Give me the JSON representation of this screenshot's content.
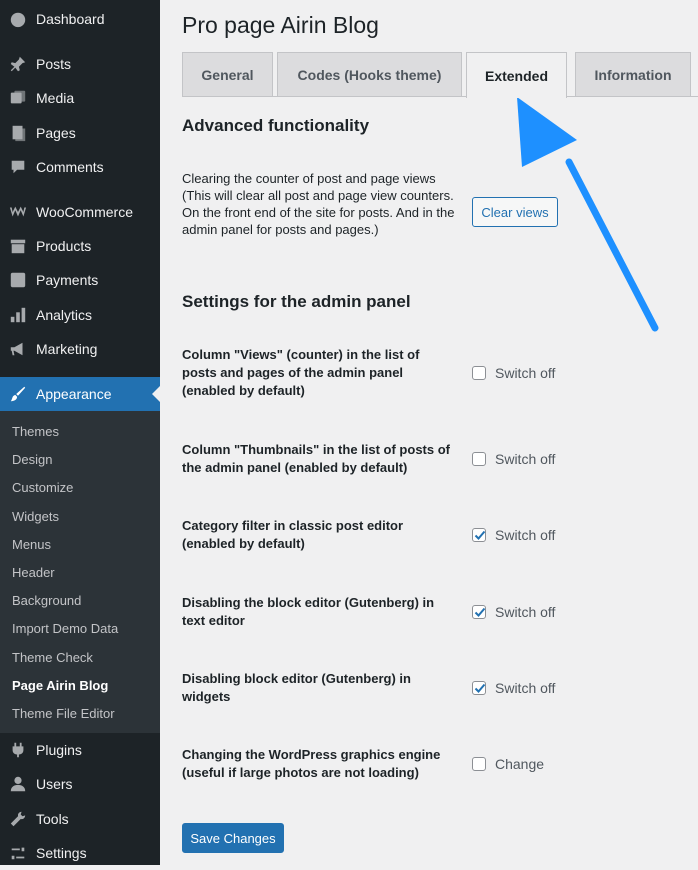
{
  "sidebar": {
    "items": [
      {
        "label": "Dashboard",
        "icon": "dashboard-icon"
      },
      {
        "label": "Posts",
        "icon": "pin-icon"
      },
      {
        "label": "Media",
        "icon": "media-icon"
      },
      {
        "label": "Pages",
        "icon": "pages-icon"
      },
      {
        "label": "Comments",
        "icon": "comments-icon"
      },
      {
        "label": "WooCommerce",
        "icon": "woocommerce-icon"
      },
      {
        "label": "Products",
        "icon": "products-icon"
      },
      {
        "label": "Payments",
        "icon": "payments-icon"
      },
      {
        "label": "Analytics",
        "icon": "analytics-icon"
      },
      {
        "label": "Marketing",
        "icon": "megaphone-icon"
      },
      {
        "label": "Appearance",
        "icon": "paintbrush-icon"
      },
      {
        "label": "Plugins",
        "icon": "plugins-icon"
      },
      {
        "label": "Users",
        "icon": "users-icon"
      },
      {
        "label": "Tools",
        "icon": "wrench-icon"
      },
      {
        "label": "Settings",
        "icon": "settings-icon"
      }
    ],
    "submenu": [
      "Themes",
      "Design",
      "Customize",
      "Widgets",
      "Menus",
      "Header",
      "Background",
      "Import Demo Data",
      "Theme Check",
      "Page Airin Blog",
      "Theme File Editor"
    ]
  },
  "page": {
    "title": "Pro page Airin Blog"
  },
  "tabs": [
    "General",
    "Codes (Hooks theme)",
    "Extended",
    "Information"
  ],
  "advanced": {
    "heading": "Advanced functionality",
    "description": "Clearing the counter of post and page views (This will clear all post and page view counters. On the front end of the site for posts. And in the admin panel for posts and pages.)",
    "button": "Clear views"
  },
  "admin": {
    "heading": "Settings for the admin panel",
    "rows": [
      {
        "label": "Column \"Views\" (counter) in the list of posts and pages of the admin panel (enabled by default)",
        "option": "Switch off",
        "checked": false
      },
      {
        "label": "Column \"Thumbnails\" in the list of posts of the admin panel (enabled by default)",
        "option": "Switch off",
        "checked": false
      },
      {
        "label": "Category filter in classic post editor (enabled by default)",
        "option": "Switch off",
        "checked": true
      },
      {
        "label": "Disabling the block editor (Gutenberg) in text editor",
        "option": "Switch off",
        "checked": true
      },
      {
        "label": "Disabling block editor (Gutenberg) in widgets",
        "option": "Switch off",
        "checked": true
      },
      {
        "label": "Changing the WordPress graphics engine (useful if large photos are not loading)",
        "option": "Change",
        "checked": false
      }
    ]
  },
  "save_button": "Save Changes",
  "colors": {
    "sidebar": "#1d2327",
    "accent": "#2271b1",
    "arrow": "#1e90ff"
  }
}
